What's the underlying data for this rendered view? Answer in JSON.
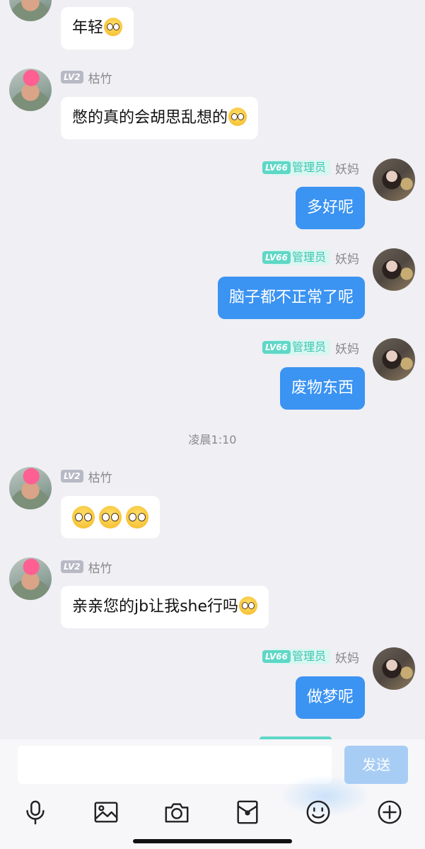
{
  "messages": [
    {
      "side": "left",
      "text": "年轻",
      "emoji": true
    },
    {
      "side": "left",
      "level": "LV2",
      "name": "枯竹",
      "text": "憋的真的会胡思乱想的",
      "emoji": true
    },
    {
      "side": "right",
      "level": "LV66",
      "role": "管理员",
      "name": "妖妈",
      "text": "多好呢"
    },
    {
      "side": "right",
      "level": "LV66",
      "role": "管理员",
      "name": "妖妈",
      "text": "脑子都不正常了呢"
    },
    {
      "side": "right",
      "level": "LV66",
      "role": "管理员",
      "name": "妖妈",
      "text": "废物东西"
    },
    {
      "side": "left",
      "level": "LV2",
      "name": "枯竹",
      "text": "",
      "emoji_count": 3
    },
    {
      "side": "left",
      "level": "LV2",
      "name": "枯竹",
      "text": "亲亲您的jb让我she行吗",
      "emoji": true
    },
    {
      "side": "right",
      "level": "LV66",
      "role": "管理员",
      "name": "妖妈",
      "text": "做梦呢"
    }
  ],
  "timestamp": "凌晨1:10",
  "composer": {
    "input_value": "",
    "send_label": "发送",
    "tools": [
      "microphone-icon",
      "image-icon",
      "camera-icon",
      "red-packet-icon",
      "emoji-icon",
      "plus-icon"
    ]
  },
  "colors": {
    "background": "#efeff4",
    "outgoing_bubble": "#3b93f2",
    "incoming_bubble": "#ffffff",
    "admin_tag": "#5fd7c6",
    "send_button_disabled": "#a8cdf5"
  }
}
